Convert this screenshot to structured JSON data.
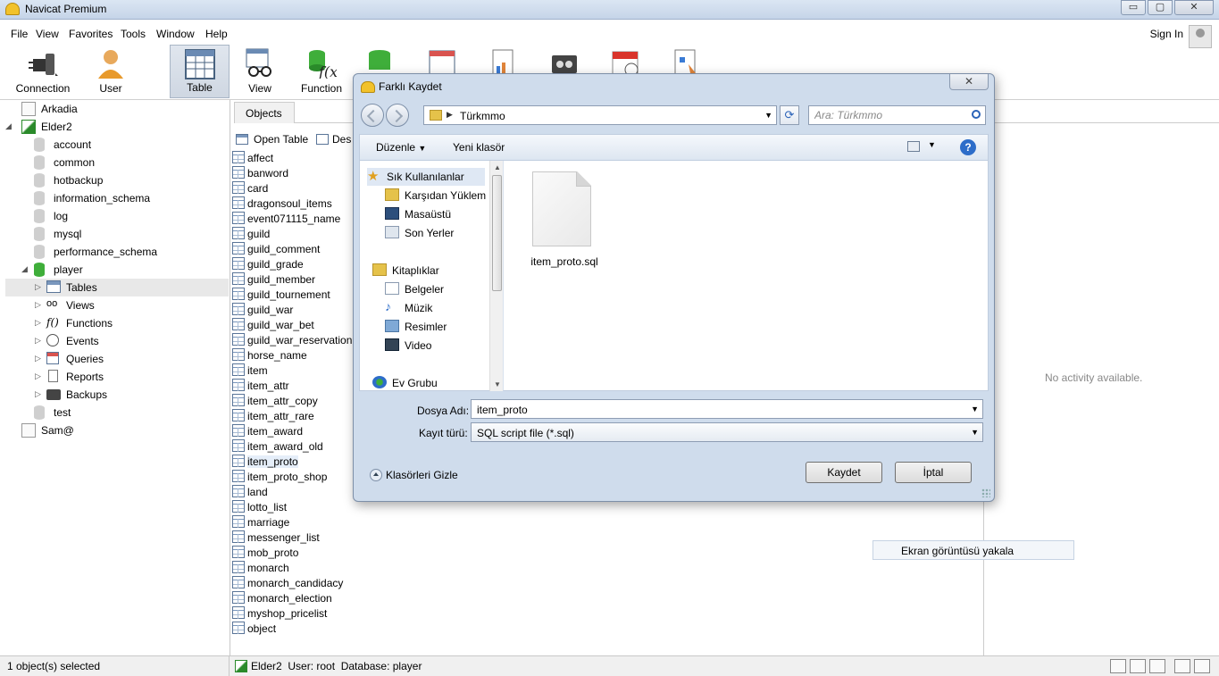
{
  "app": {
    "title": "Navicat Premium"
  },
  "window_controls": {
    "minimize": "▭",
    "maximize": "▢",
    "close": "✕"
  },
  "menu": [
    "File",
    "View",
    "Favorites",
    "Tools",
    "Window",
    "Help"
  ],
  "signin": "Sign In",
  "toolbar": [
    {
      "label": "Connection",
      "icon": "plug-icon"
    },
    {
      "label": "User",
      "icon": "user-icon"
    },
    {
      "label": "Table",
      "icon": "table-icon",
      "active": true
    },
    {
      "label": "View",
      "icon": "glasses-icon"
    },
    {
      "label": "Function",
      "icon": "function-icon"
    }
  ],
  "tree": {
    "connections": [
      {
        "label": "Arkadia"
      },
      {
        "label": "Elder2"
      },
      {
        "label": "Sam@"
      }
    ],
    "databases": [
      "account",
      "common",
      "hotbackup",
      "information_schema",
      "log",
      "mysql",
      "performance_schema",
      "player",
      "test"
    ],
    "player_children": [
      "Tables",
      "Views",
      "Functions",
      "Events",
      "Queries",
      "Reports",
      "Backups"
    ]
  },
  "objects": {
    "tab": "Objects",
    "actions": [
      "Open Table",
      "Des"
    ],
    "tables": [
      "affect",
      "banword",
      "card",
      "dragonsoul_items",
      "event071115_name",
      "guild",
      "guild_comment",
      "guild_grade",
      "guild_member",
      "guild_tournement",
      "guild_war",
      "guild_war_bet",
      "guild_war_reservation",
      "horse_name",
      "item",
      "item_attr",
      "item_attr_copy",
      "item_attr_rare",
      "item_award",
      "item_award_old",
      "item_proto",
      "item_proto_shop",
      "land",
      "lotto_list",
      "marriage",
      "messenger_list",
      "mob_proto",
      "monarch",
      "monarch_candidacy",
      "monarch_election",
      "myshop_pricelist",
      "object"
    ],
    "selected": "item_proto"
  },
  "no_activity": "No activity available.",
  "tooltip": "Ekran görüntüsü yakala",
  "status": {
    "left": "1 object(s) selected",
    "connection": "Elder2",
    "user": "User: root",
    "database": "Database: player"
  },
  "dialog": {
    "title": "Farklı Kaydet",
    "close": "✕",
    "path": "Türkmmo",
    "search_placeholder": "Ara: Türkmmo",
    "organize": "Düzenle",
    "new_folder": "Yeni klasör",
    "help": "?",
    "favorites_header": "Sık Kullanılanlar",
    "favorites": [
      "Karşıdan Yüklem",
      "Masaüstü",
      "Son Yerler"
    ],
    "libraries_header": "Kitaplıklar",
    "libraries": [
      "Belgeler",
      "Müzik",
      "Resimler",
      "Video"
    ],
    "homegroup": "Ev Grubu",
    "file": {
      "name": "item_proto.sql"
    },
    "filename_label": "Dosya Adı:",
    "filename_value": "item_proto",
    "filetype_label": "Kayıt türü:",
    "filetype_value": "SQL script file (*.sql)",
    "hide_folders": "Klasörleri Gizle",
    "save": "Kaydet",
    "cancel": "İptal"
  }
}
